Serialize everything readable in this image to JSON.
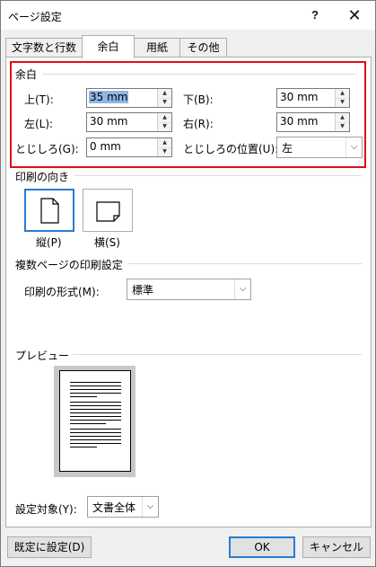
{
  "window": {
    "title": "ページ設定",
    "help_glyph": "?",
    "close_glyph": "✕"
  },
  "tabs": [
    {
      "label": "文字数と行数",
      "active": false
    },
    {
      "label": "余白",
      "active": true
    },
    {
      "label": "用紙",
      "active": false
    },
    {
      "label": "その他",
      "active": false
    }
  ],
  "margins": {
    "group_title": "余白",
    "top": {
      "label": "上(T):",
      "value": "35 mm"
    },
    "bottom": {
      "label": "下(B):",
      "value": "30 mm"
    },
    "left": {
      "label": "左(L):",
      "value": "30 mm"
    },
    "right": {
      "label": "右(R):",
      "value": "30 mm"
    },
    "gutter": {
      "label": "とじしろ(G):",
      "value": "0 mm"
    },
    "gutter_pos": {
      "label": "とじしろの位置(U):",
      "value": "左"
    }
  },
  "orientation": {
    "group_title": "印刷の向き",
    "portrait": "縦(P)",
    "landscape": "横(S)",
    "selected": "portrait"
  },
  "multiple_pages": {
    "group_title": "複数ページの印刷設定",
    "label": "印刷の形式(M):",
    "value": "標準"
  },
  "preview": {
    "group_title": "プレビュー"
  },
  "apply_to": {
    "label": "設定対象(Y):",
    "value": "文書全体"
  },
  "buttons": {
    "default": "既定に設定(D)",
    "ok": "OK",
    "cancel": "キャンセル"
  },
  "colors": {
    "highlight_border": "#e20f12",
    "accent": "#2a7bd1",
    "selection": "#8fb6e6"
  },
  "icons": {
    "spin_up": "▲",
    "spin_down": "▼",
    "dropdown": "⌵"
  }
}
